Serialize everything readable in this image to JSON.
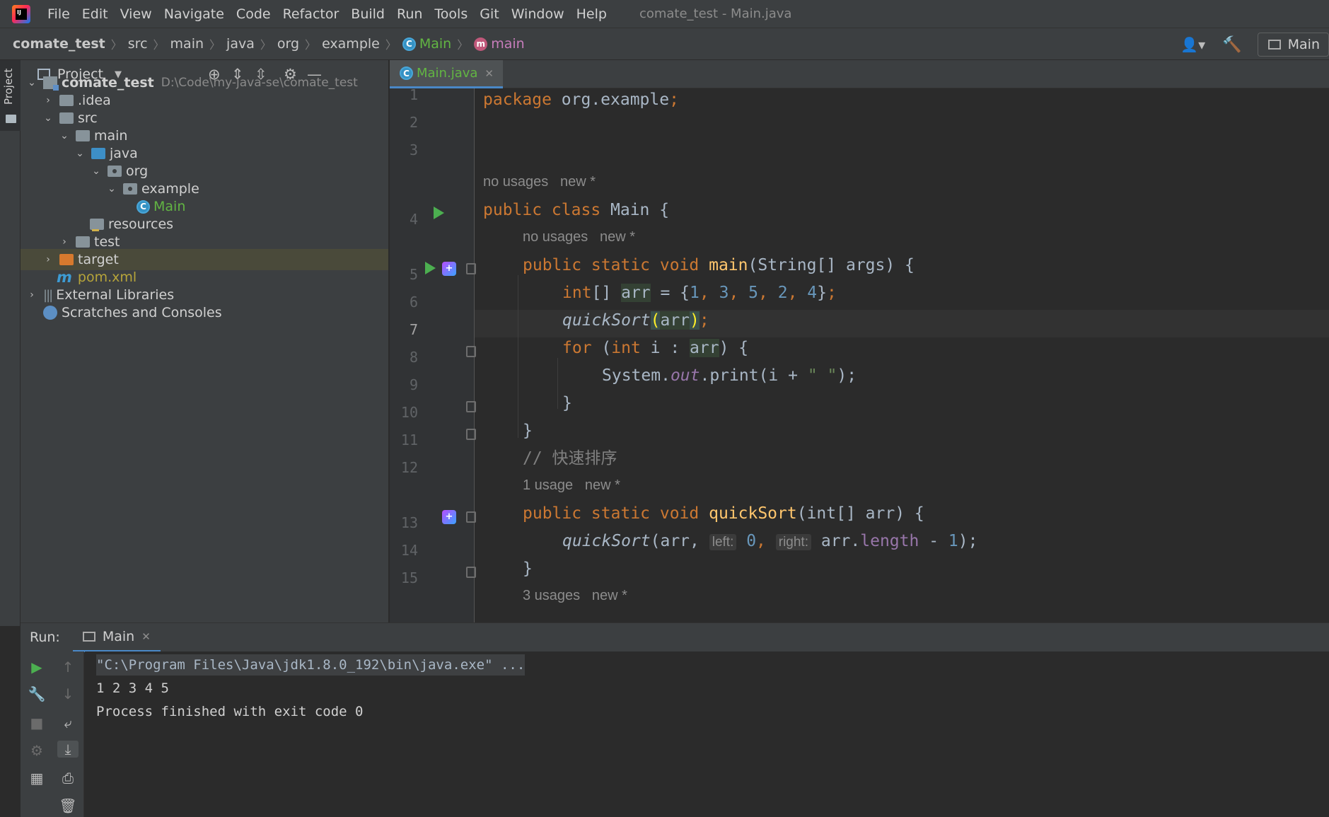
{
  "menubar": {
    "logo_text": "IJ",
    "items": [
      "File",
      "Edit",
      "View",
      "Navigate",
      "Code",
      "Refactor",
      "Build",
      "Run",
      "Tools",
      "Git",
      "Window",
      "Help"
    ],
    "window_title": "comate_test - Main.java"
  },
  "navbar": {
    "breadcrumbs": [
      "comate_test",
      "src",
      "main",
      "java",
      "org",
      "example",
      "Main",
      "main"
    ],
    "run_config": "Main"
  },
  "left_stripe": {
    "project_label": "Project"
  },
  "project_panel": {
    "title": "Project",
    "root": {
      "name": "comate_test",
      "path": "D:\\Code\\my-java-se\\comate_test"
    },
    "nodes": [
      ".idea",
      "src",
      "main",
      "java",
      "org",
      "example",
      "Main",
      "resources",
      "test",
      "target",
      "pom.xml",
      "External Libraries",
      "Scratches and Consoles"
    ]
  },
  "editor": {
    "tab": "Main.java",
    "line_numbers": [
      "1",
      "2",
      "3",
      "4",
      "5",
      "6",
      "7",
      "8",
      "9",
      "10",
      "11",
      "12",
      "13",
      "14",
      "15"
    ],
    "hints": {
      "class_usage": "no usages   new *",
      "main_usage": "no usages   new *",
      "quicksort_usage": "1 usage   new *",
      "last_usage": "3 usages   new *"
    },
    "code": {
      "pkg_kw": "package",
      "pkg_name": " org.example",
      "semi": ";",
      "class_mods": "public class",
      "class_name": " Main {",
      "main_mods": "public static void",
      "main_name": " main",
      "main_params": "(String[] args) {",
      "arr_type": "int",
      "arr_brackets": "[] ",
      "arr_var": "arr",
      "arr_assign": " = {",
      "n1": "1",
      "n3": "3",
      "n5": "5",
      "n2": "2",
      "n4": "4",
      "comma": ", ",
      "arr_end": "}",
      "qs_call": "quickSort",
      "paren_open": "(",
      "paren_close": ")",
      "for_kw": "for",
      "for_open": " (",
      "for_int": "int",
      "for_mid": " i : ",
      "for_close": ") {",
      "sys": "System.",
      "out": "out",
      "print": ".print(i + ",
      "space_str": "\" \"",
      "print_end": ");",
      "close_brace": "}",
      "comment": "// 快速排序",
      "qs_decl_mods": "public static void",
      "qs_decl_name": " quickSort",
      "qs_decl_params": "(int[] arr) {",
      "qs_call2": "quickSort",
      "qs_call2_open": "(arr, ",
      "hint_left": "left:",
      "zero": " 0",
      "comma2": ", ",
      "hint_right": "right:",
      "arr_len": " arr.",
      "length": "length",
      "minus": " - ",
      "one": "1",
      "qs_end": ");"
    }
  },
  "run_panel": {
    "label": "Run:",
    "tab": "Main",
    "console": [
      "\"C:\\Program Files\\Java\\jdk1.8.0_192\\bin\\java.exe\" ...",
      "1 2 3 4 5",
      "Process finished with exit code 0"
    ]
  },
  "colors": {
    "keyword": "#cc7832",
    "number": "#6897bb",
    "function": "#ffc66d",
    "string": "#6a8759",
    "field": "#9876aa",
    "accent": "#4a88c7"
  }
}
